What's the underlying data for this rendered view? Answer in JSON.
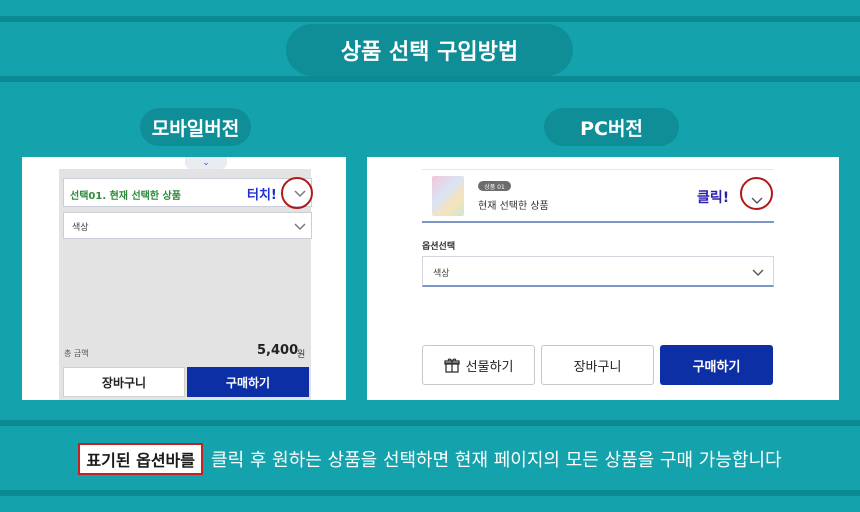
{
  "header": {
    "title": "상품 선택 구입방법"
  },
  "mobile": {
    "section_label": "모바일버전",
    "option1_label": "선택01. 현재 선택한 상품",
    "touch_label": "터치!",
    "option2_label": "색상",
    "total_label": "총 금액",
    "total_amount": "5,400",
    "total_unit": "원",
    "cart_label": "장바구니",
    "buy_label": "구매하기"
  },
  "pc": {
    "section_label": "PC버전",
    "product_badge": "상품 01",
    "product_name": "현재 선택한 상품",
    "click_label": "클릭!",
    "option_section_label": "옵션선택",
    "option_label": "색상",
    "gift_label": "선물하기",
    "cart_label": "장바구니",
    "buy_label": "구매하기"
  },
  "footer": {
    "highlight": "표기된 옵션바를",
    "text": "클릭 후 원하는 상품을 선택하면 현재 페이지의 모든 상품을 구매 가능합니다"
  },
  "colors": {
    "background": "#14a2ad",
    "pill": "#0f8e98",
    "buy_button": "#0d2fa6",
    "highlight_circle": "#b11a1a"
  },
  "icons": [
    "chevron-down-icon",
    "gift-icon"
  ]
}
